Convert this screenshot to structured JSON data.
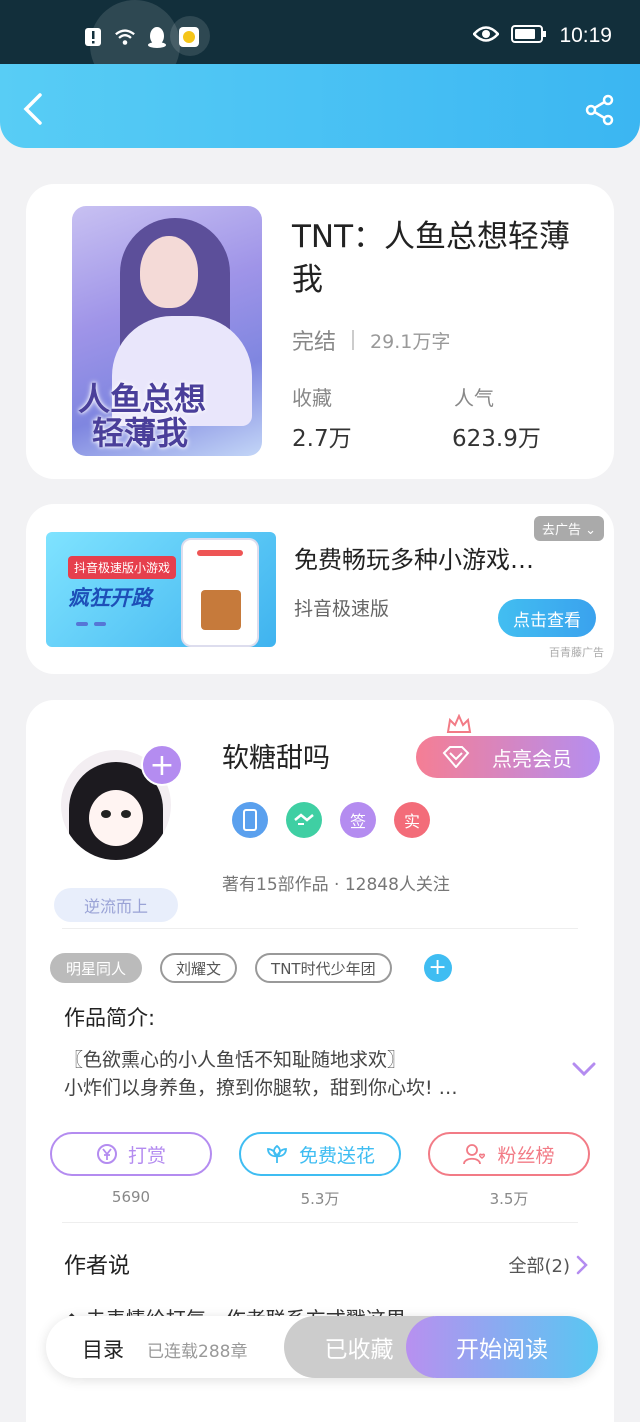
{
  "status_bar": {
    "time": "10:19"
  },
  "book": {
    "title": "TNT：人鱼总想轻薄我",
    "cover_title_line1": "人鱼总想",
    "cover_title_line2": "轻薄我",
    "status": "完结",
    "word_count": "29.1万字",
    "favorites_label": "收藏",
    "favorites_value": "2.7万",
    "popularity_label": "人气",
    "popularity_value": "623.9万"
  },
  "ad": {
    "image_tag": "抖音极速版小游戏",
    "image_headline": "疯狂开路",
    "title": "免费畅玩多种小游戏…",
    "source": "抖音极速版",
    "close_label": "去广告",
    "cta_label": "点击查看",
    "brand": "百青藤广告"
  },
  "author": {
    "name": "软糖甜吗",
    "badge": "逆流而上",
    "vip_label": "点亮会员",
    "honors": [
      {
        "icon": "phone-medal-icon",
        "color": "#5aa0ee",
        "label": ""
      },
      {
        "icon": "handshake-medal-icon",
        "color": "#3fcfa3",
        "label": ""
      },
      {
        "icon": "sign-badge-icon",
        "color": "#b48cf0",
        "label": "签"
      },
      {
        "icon": "verified-badge-icon",
        "color": "#f36c79",
        "label": "实"
      }
    ],
    "meta": "著有15部作品 · 12848人关注"
  },
  "tags": [
    "明星同人",
    "刘耀文",
    "TNT时代少年团"
  ],
  "intro": {
    "heading": "作品简介:",
    "line1": "〖色欲熏心的小人鱼恬不知耻随地求欢〗",
    "line2": "小炸们以身养鱼，撩到你腿软，甜到你心坎! …"
  },
  "actions": [
    {
      "label": "打赏",
      "count": "5690",
      "color": "#b48cf0"
    },
    {
      "label": "免费送花",
      "count": "5.3万",
      "color": "#3fbdf2"
    },
    {
      "label": "粉丝榜",
      "count": "3.5万",
      "color": "#f27b86"
    }
  ],
  "author_says": {
    "heading": "作者说",
    "all_label": "全部(2)",
    "peek": "◆ 去表情给打气，作者联系方式戳这里"
  },
  "bottom_bar": {
    "toc": "目录",
    "serial": "已连载288章",
    "favorited": "已收藏",
    "start_reading": "开始阅读"
  },
  "colors": {
    "header": "#3bb6f2",
    "accent_purple": "#b48cf0",
    "accent_blue": "#3fbdf2",
    "accent_red": "#f27b86"
  }
}
